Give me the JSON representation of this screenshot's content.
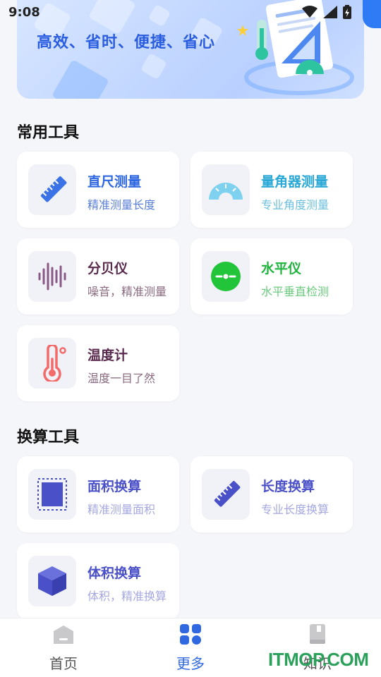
{
  "status_bar": {
    "time": "9:08"
  },
  "banner": {
    "slogan": "高效、省时、便捷、省心"
  },
  "sections": [
    {
      "title": "常用工具"
    },
    {
      "title": "换算工具"
    }
  ],
  "common_tools": [
    {
      "title": "直尺测量",
      "subtitle": "精准测量长度",
      "icon": "ruler-icon",
      "title_color": "#2f68e0",
      "sub_color": "#5a7fd8"
    },
    {
      "title": "量角器测量",
      "subtitle": "专业角度测量",
      "icon": "protractor-icon",
      "title_color": "#2aa8d6",
      "sub_color": "#6cc0de"
    },
    {
      "title": "分贝仪",
      "subtitle": "噪音，精准测量",
      "icon": "sound-wave-icon",
      "title_color": "#5a2a4d",
      "sub_color": "#8a6a80"
    },
    {
      "title": "水平仪",
      "subtitle": "水平垂直检测",
      "icon": "level-icon",
      "title_color": "#1fb43b",
      "sub_color": "#6acb7d"
    },
    {
      "title": "温度计",
      "subtitle": "温度一目了然",
      "icon": "thermometer-icon",
      "title_color": "#5a2a4d",
      "sub_color": "#8a6a80"
    }
  ],
  "conversion_tools": [
    {
      "title": "面积换算",
      "subtitle": "精准测量面积",
      "icon": "area-icon",
      "title_color": "#4a50c8",
      "sub_color": "#a5a8e0"
    },
    {
      "title": "长度换算",
      "subtitle": "专业长度换算",
      "icon": "ruler-icon",
      "title_color": "#4a50c8",
      "sub_color": "#a5a8e0"
    },
    {
      "title": "体积换算",
      "subtitle": "体积，精准换算",
      "icon": "cube-icon",
      "title_color": "#4a50c8",
      "sub_color": "#a5a8e0"
    }
  ],
  "tabbar": [
    {
      "label": "首页",
      "icon": "home-icon",
      "active": false
    },
    {
      "label": "更多",
      "icon": "grid-icon",
      "active": true
    },
    {
      "label": "知识",
      "icon": "book-icon",
      "active": false
    }
  ],
  "watermark": "ITMOP.COM",
  "colors": {
    "accent": "#2f68e0",
    "inactive": "#555555"
  }
}
